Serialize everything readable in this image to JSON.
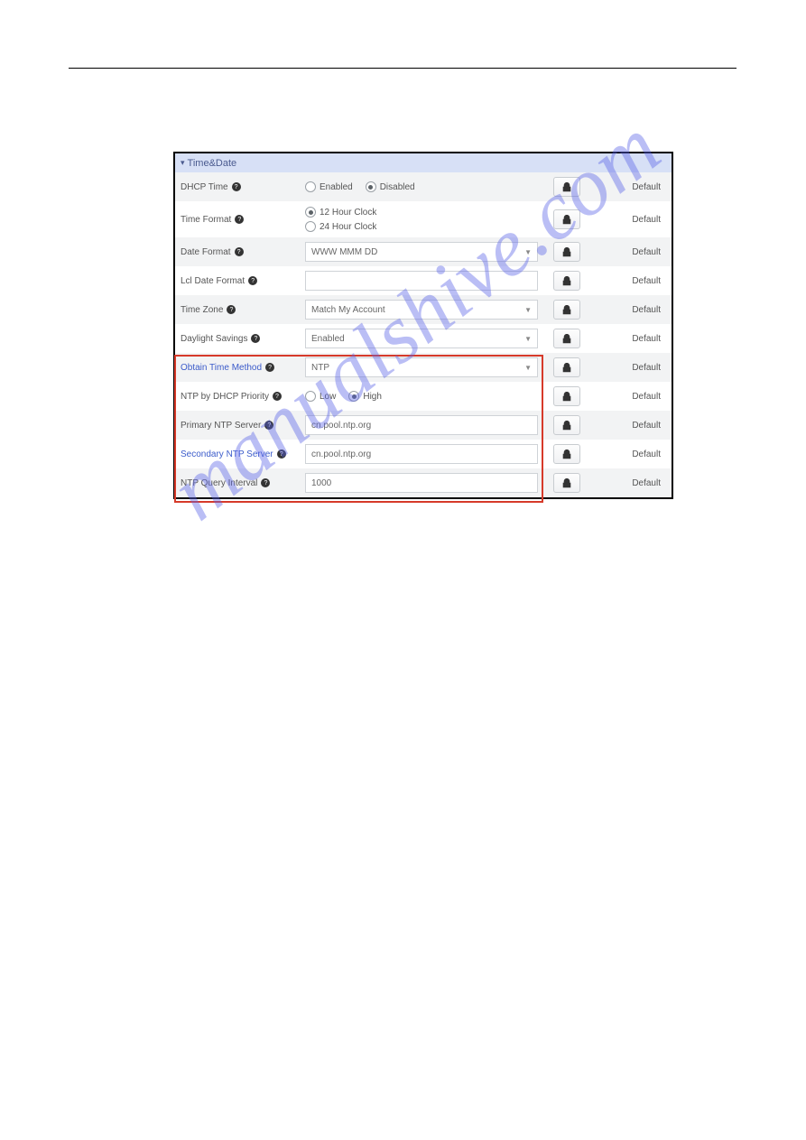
{
  "section_title": "Time&Date",
  "default_label": "Default",
  "rows": {
    "dhcp_time": {
      "label": "DHCP Time",
      "opt_enabled": "Enabled",
      "opt_disabled": "Disabled"
    },
    "time_format": {
      "label": "Time Format",
      "opt_12": "12 Hour Clock",
      "opt_24": "24 Hour Clock"
    },
    "date_format": {
      "label": "Date Format",
      "value": "WWW MMM DD"
    },
    "lcl_date_format": {
      "label": "Lcl Date Format",
      "value": ""
    },
    "time_zone": {
      "label": "Time Zone",
      "value": "Match My Account"
    },
    "daylight_savings": {
      "label": "Daylight Savings",
      "value": "Enabled"
    },
    "obtain_time": {
      "label": "Obtain Time Method",
      "value": "NTP"
    },
    "ntp_dhcp_priority": {
      "label": "NTP by DHCP Priority",
      "opt_low": "Low",
      "opt_high": "High"
    },
    "primary_ntp": {
      "label": "Primary NTP Server",
      "value": "cn.pool.ntp.org"
    },
    "secondary_ntp": {
      "label": "Secondary NTP Server",
      "value": "cn.pool.ntp.org"
    },
    "ntp_query_interval": {
      "label": "NTP Query Interval",
      "value": "1000"
    }
  },
  "watermark_text": "manualshive.com"
}
